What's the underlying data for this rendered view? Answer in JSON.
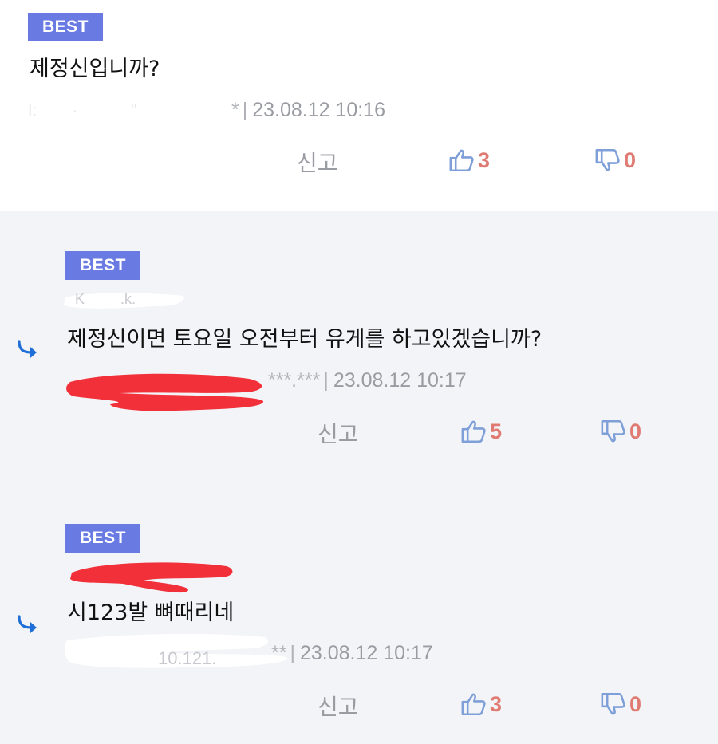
{
  "comments": [
    {
      "badge": "BEST",
      "text": "제정신입니까?",
      "ip": "*",
      "datetime": "23.08.12 10:16",
      "report": "신고",
      "likes": "3",
      "dislikes": "0"
    },
    {
      "badge": "BEST",
      "text": "제정신이면 토요일 오전부터 유게를 하고있겠습니까?",
      "ip": "***.***",
      "datetime": "23.08.12 10:17",
      "report": "신고",
      "likes": "5",
      "dislikes": "0"
    },
    {
      "badge": "BEST",
      "text": "시123발 뼈때리네",
      "ip": "**",
      "datetime": "23.08.12 10:17",
      "report": "신고",
      "likes": "3",
      "dislikes": "0"
    }
  ],
  "colors": {
    "badge": "#6a7ae3",
    "reply_arrow": "#1f6fd6",
    "thumb": "#7f9fd9",
    "count": "#e07b73",
    "redaction_red": "#f2303a"
  },
  "icons": {
    "reply": "reply-arrow-icon",
    "like": "thumbs-up-icon",
    "dislike": "thumbs-down-icon"
  }
}
